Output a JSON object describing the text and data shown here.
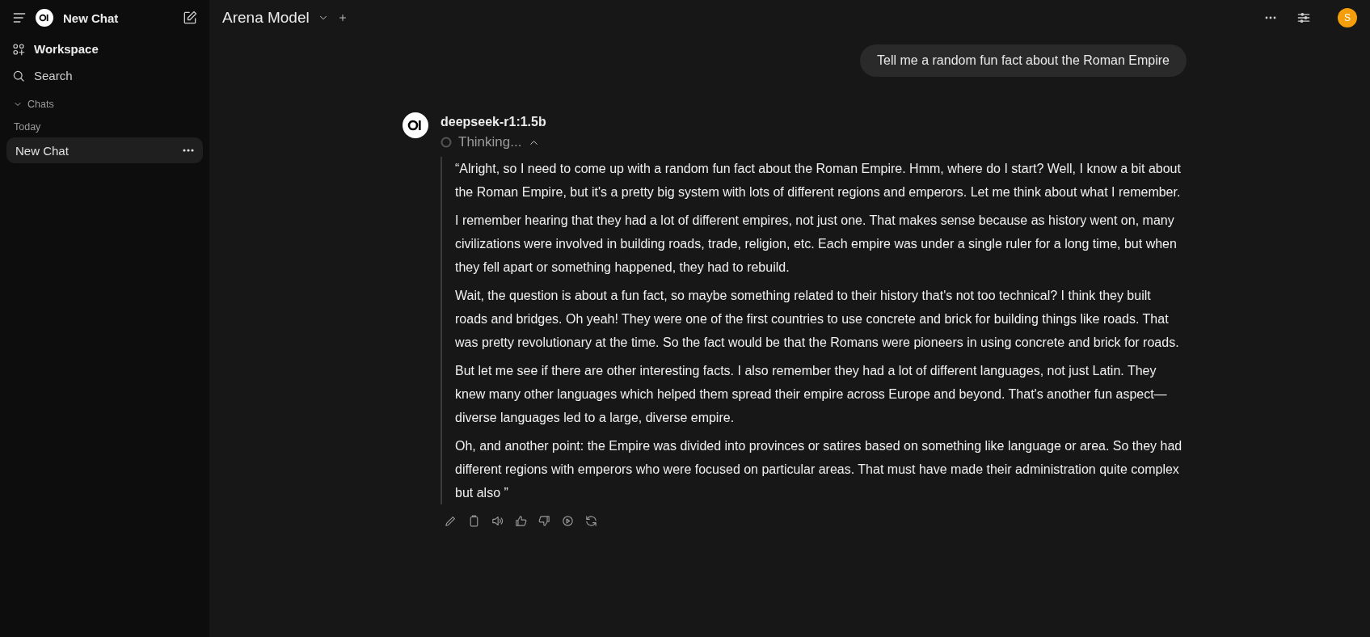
{
  "sidebar": {
    "title": "New Chat",
    "nav": [
      {
        "kind": "workspace",
        "label": "Workspace"
      },
      {
        "kind": "search",
        "label": "Search"
      }
    ],
    "section": {
      "label": "Chats",
      "expanded": true
    },
    "groups": [
      {
        "label": "Today",
        "items": [
          {
            "label": "New Chat",
            "selected": true
          }
        ]
      }
    ]
  },
  "header": {
    "model": "Arena Model",
    "avatar": "S"
  },
  "messages": [
    {
      "kind": "user",
      "text": "Tell me a random fun fact about the Roman Empire"
    },
    {
      "kind": "assistant",
      "model": "deepseek-r1:1.5b",
      "status": "Thinking...",
      "expanded": true,
      "paragraphs": [
        "“Alright, so I need to come up with a random fun fact about the Roman Empire. Hmm, where do I start? Well, I know a bit about the Roman Empire, but it's a pretty big system with lots of different regions and emperors. Let me think about what I remember.",
        "I remember hearing that they had a lot of different empires, not just one. That makes sense because as history went on, many civilizations were involved in building roads, trade, religion, etc. Each empire was under a single ruler for a long time, but when they fell apart or something happened, they had to rebuild.",
        "Wait, the question is about a fun fact, so maybe something related to their history that's not too technical? I think they built roads and bridges. Oh yeah! They were one of the first countries to use concrete and brick for building things like roads. That was pretty revolutionary at the time. So the fact would be that the Romans were pioneers in using concrete and brick for roads.",
        "But let me see if there are other interesting facts. I also remember they had a lot of different languages, not just Latin. They knew many other languages which helped them spread their empire across Europe and beyond. That's another fun aspect—diverse languages led to a large, diverse empire.",
        "Oh, and another point: the Empire was divided into provinces or satires based on something like language or area. So they had different regions with emperors who were focused on particular areas. That must have made their administration quite complex but also ”"
      ]
    }
  ]
}
